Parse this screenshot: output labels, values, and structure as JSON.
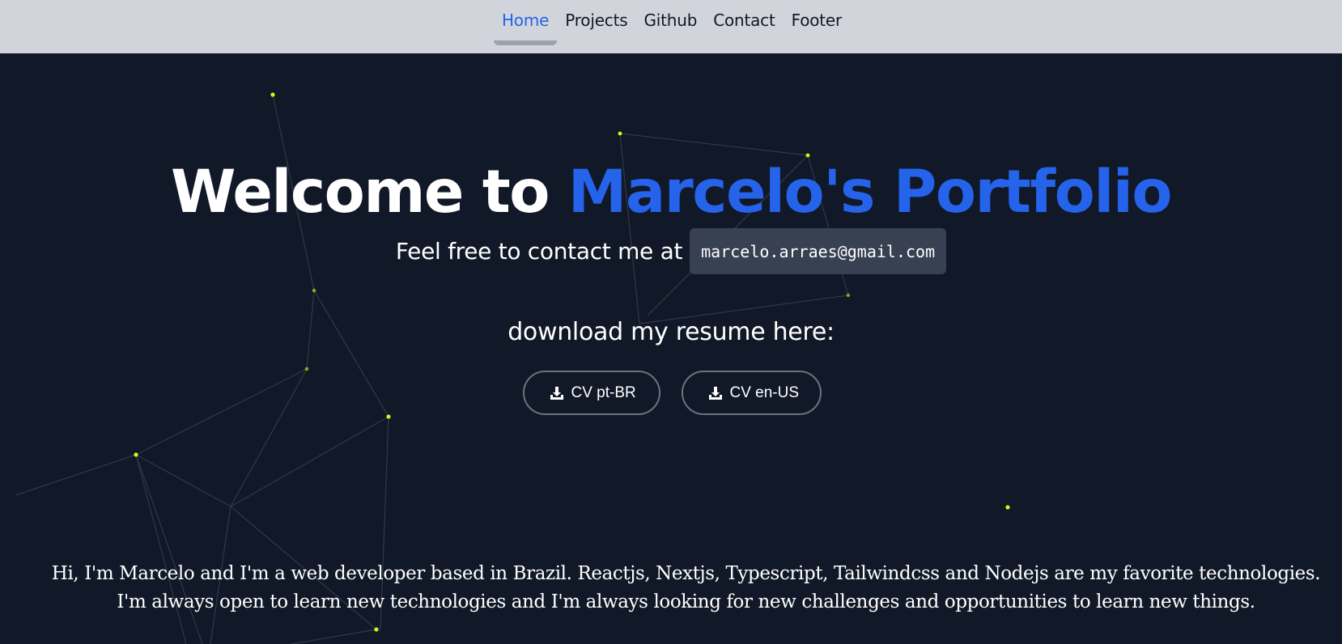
{
  "nav": {
    "items": [
      {
        "label": "Home",
        "active": true
      },
      {
        "label": "Projects",
        "active": false
      },
      {
        "label": "Github",
        "active": false
      },
      {
        "label": "Contact",
        "active": false
      },
      {
        "label": "Footer",
        "active": false
      }
    ]
  },
  "hero": {
    "title_prefix": "Welcome to ",
    "title_accent": "Marcelo's Portfolio",
    "contact_text": "Feel free to contact me at",
    "email": "marcelo.arraes@gmail.com",
    "resume_label": "download my resume here:",
    "cv_buttons": [
      {
        "label": "CV pt-BR",
        "icon": "download-icon"
      },
      {
        "label": "CV en-US",
        "icon": "download-icon"
      }
    ]
  },
  "bio": {
    "text": "Hi, I'm Marcelo and I'm a web developer based in Brazil. Reactjs, Nextjs, Typescript, Tailwindcss and Nodejs are my favorite technologies. I'm always open to learn new technologies and I'm always looking for new challenges and opportunities to learn new things."
  },
  "colors": {
    "background": "#111827",
    "navbar": "#d1d5db",
    "accent": "#2563eb",
    "particle": "#d9f218",
    "email_chip": "#374151"
  }
}
